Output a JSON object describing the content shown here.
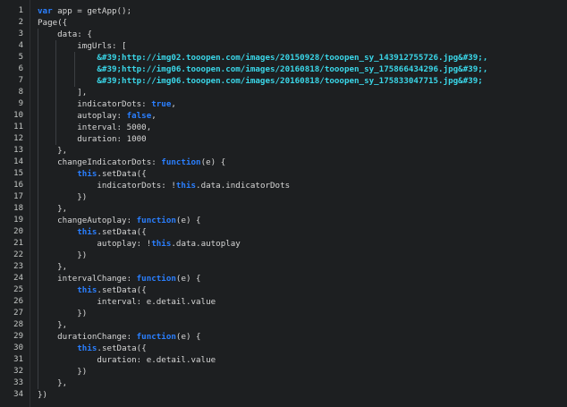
{
  "editor": {
    "line_numbers": [
      "1",
      "2",
      "3",
      "4",
      "5",
      "6",
      "7",
      "8",
      "9",
      "10",
      "11",
      "12",
      "13",
      "14",
      "15",
      "16",
      "17",
      "18",
      "19",
      "20",
      "21",
      "22",
      "23",
      "24",
      "25",
      "26",
      "27",
      "28",
      "29",
      "30",
      "31",
      "32",
      "33",
      "34"
    ],
    "lines": [
      [
        {
          "t": "var",
          "k": "kw"
        },
        {
          "t": " app = getApp();",
          "k": "pl"
        }
      ],
      [
        {
          "t": "Page({",
          "k": "pl"
        }
      ],
      [
        {
          "t": "    data: {",
          "k": "pl"
        }
      ],
      [
        {
          "t": "        imgUrls: [",
          "k": "pl"
        }
      ],
      [
        {
          "t": "            ",
          "k": "pl"
        },
        {
          "t": "&#39;http://img02.tooopen.com/images/20150928/tooopen_sy_143912755726.jpg&#39;,",
          "k": "str"
        }
      ],
      [
        {
          "t": "            ",
          "k": "pl"
        },
        {
          "t": "&#39;http://img06.tooopen.com/images/20160818/tooopen_sy_175866434296.jpg&#39;,",
          "k": "str"
        }
      ],
      [
        {
          "t": "            ",
          "k": "pl"
        },
        {
          "t": "&#39;http://img06.tooopen.com/images/20160818/tooopen_sy_175833047715.jpg&#39;",
          "k": "str"
        }
      ],
      [
        {
          "t": "        ],",
          "k": "pl"
        }
      ],
      [
        {
          "t": "        indicatorDots: ",
          "k": "pl"
        },
        {
          "t": "true",
          "k": "kw"
        },
        {
          "t": ",",
          "k": "pl"
        }
      ],
      [
        {
          "t": "        autoplay: ",
          "k": "pl"
        },
        {
          "t": "false",
          "k": "kw"
        },
        {
          "t": ",",
          "k": "pl"
        }
      ],
      [
        {
          "t": "        interval: 5000,",
          "k": "pl"
        }
      ],
      [
        {
          "t": "        duration: 1000",
          "k": "pl"
        }
      ],
      [
        {
          "t": "    },",
          "k": "pl"
        }
      ],
      [
        {
          "t": "    changeIndicatorDots: ",
          "k": "pl"
        },
        {
          "t": "function",
          "k": "kw"
        },
        {
          "t": "(e) {",
          "k": "pl"
        }
      ],
      [
        {
          "t": "        ",
          "k": "pl"
        },
        {
          "t": "this",
          "k": "kw"
        },
        {
          "t": ".setData({",
          "k": "pl"
        }
      ],
      [
        {
          "t": "            indicatorDots: !",
          "k": "pl"
        },
        {
          "t": "this",
          "k": "kw"
        },
        {
          "t": ".data.indicatorDots",
          "k": "pl"
        }
      ],
      [
        {
          "t": "        })",
          "k": "pl"
        }
      ],
      [
        {
          "t": "    },",
          "k": "pl"
        }
      ],
      [
        {
          "t": "    changeAutoplay: ",
          "k": "pl"
        },
        {
          "t": "function",
          "k": "kw"
        },
        {
          "t": "(e) {",
          "k": "pl"
        }
      ],
      [
        {
          "t": "        ",
          "k": "pl"
        },
        {
          "t": "this",
          "k": "kw"
        },
        {
          "t": ".setData({",
          "k": "pl"
        }
      ],
      [
        {
          "t": "            autoplay: !",
          "k": "pl"
        },
        {
          "t": "this",
          "k": "kw"
        },
        {
          "t": ".data.autoplay",
          "k": "pl"
        }
      ],
      [
        {
          "t": "        })",
          "k": "pl"
        }
      ],
      [
        {
          "t": "    },",
          "k": "pl"
        }
      ],
      [
        {
          "t": "    intervalChange: ",
          "k": "pl"
        },
        {
          "t": "function",
          "k": "kw"
        },
        {
          "t": "(e) {",
          "k": "pl"
        }
      ],
      [
        {
          "t": "        ",
          "k": "pl"
        },
        {
          "t": "this",
          "k": "kw"
        },
        {
          "t": ".setData({",
          "k": "pl"
        }
      ],
      [
        {
          "t": "            interval: e.detail.value",
          "k": "pl"
        }
      ],
      [
        {
          "t": "        })",
          "k": "pl"
        }
      ],
      [
        {
          "t": "    },",
          "k": "pl"
        }
      ],
      [
        {
          "t": "    durationChange: ",
          "k": "pl"
        },
        {
          "t": "function",
          "k": "kw"
        },
        {
          "t": "(e) {",
          "k": "pl"
        }
      ],
      [
        {
          "t": "        ",
          "k": "pl"
        },
        {
          "t": "this",
          "k": "kw"
        },
        {
          "t": ".setData({",
          "k": "pl"
        }
      ],
      [
        {
          "t": "            duration: e.detail.value",
          "k": "pl"
        }
      ],
      [
        {
          "t": "        })",
          "k": "pl"
        }
      ],
      [
        {
          "t": "    },",
          "k": "pl"
        }
      ],
      [
        {
          "t": "})",
          "k": "pl"
        }
      ]
    ]
  },
  "colors": {
    "background": "#1d1f21",
    "keyword": "#2a7fff",
    "string": "#3ad6e8",
    "plain": "#d6d6d6",
    "line_number": "#c5c8c6"
  }
}
